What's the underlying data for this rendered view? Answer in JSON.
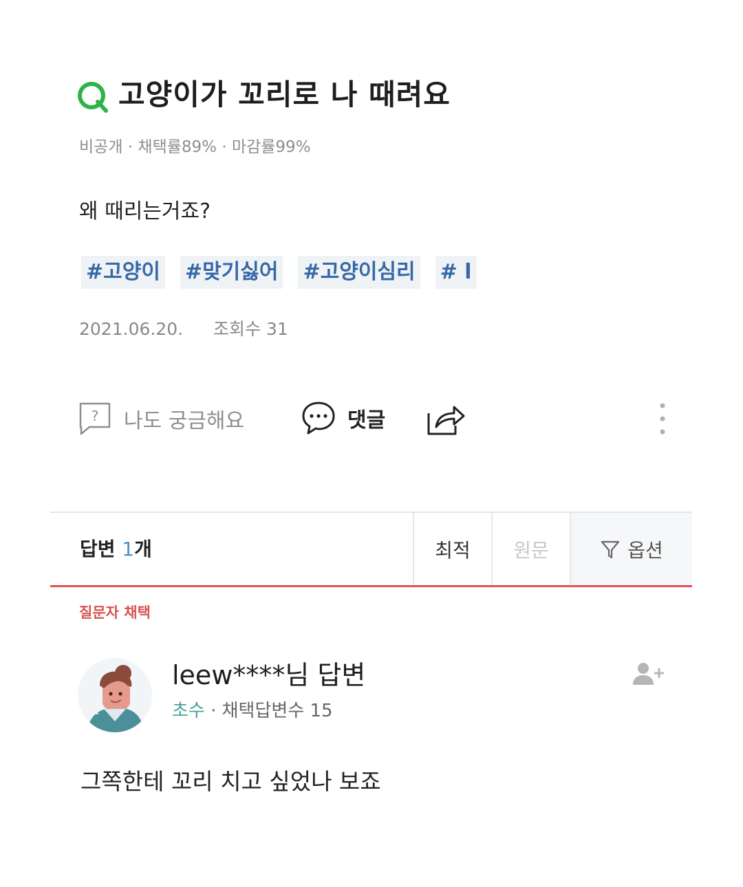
{
  "question": {
    "title": "고양이가 꼬리로 나 때려요",
    "meta": "비공개 · 채택률89% · 마감률99%",
    "body": "왜 때리는거죠?",
    "tags": [
      "#고양이",
      "#맞기싫어",
      "#고양이심리",
      "# l"
    ],
    "date": "2021.06.20.",
    "views": "조회수 31",
    "accent_color": "#2db34a"
  },
  "actions": {
    "curious_label": "나도 궁금해요",
    "comment_label": "댓글",
    "curious_icon": "question-box-icon",
    "comment_icon": "speech-bubble-icon",
    "share_icon": "share-icon",
    "more_icon": "more-vertical-icon"
  },
  "answers": {
    "count_prefix": "답변 ",
    "count_num": "1",
    "count_suffix": "개",
    "sort_best": "최적",
    "sort_original": "원문",
    "options_label": "옵션",
    "filter_icon": "filter-icon",
    "bar_accent": "#e35252"
  },
  "answer": {
    "chosen_label": "질문자 채택",
    "author": "leew****님 답변",
    "level": "초수",
    "adopted_count": " · 채택답변수 15",
    "text": "그쪽한테 꼬리 치고 싶었나 보죠",
    "avatar_icon": "user-avatar",
    "follow_icon": "add-user-icon"
  }
}
